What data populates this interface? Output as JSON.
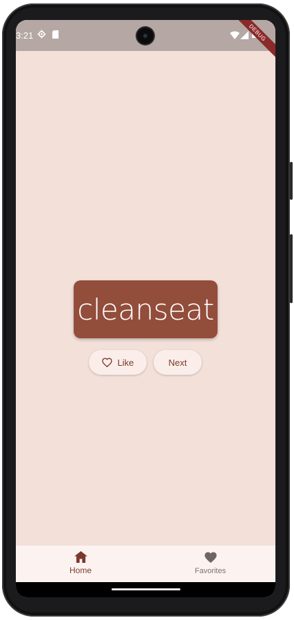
{
  "status_bar": {
    "time": "3:21",
    "left_icons": [
      "settings-icon",
      "sim-card-icon"
    ],
    "right_icons": [
      "wifi-icon",
      "signal-icon",
      "battery-icon"
    ]
  },
  "debug_banner": "DEBUG",
  "word_card": {
    "text": "cleanseat"
  },
  "actions": {
    "like_label": "Like",
    "like_icon": "heart-outline-icon",
    "next_label": "Next"
  },
  "bottom_nav": {
    "items": [
      {
        "label": "Home",
        "icon": "home-icon",
        "selected": true
      },
      {
        "label": "Favorites",
        "icon": "heart-icon",
        "selected": false
      }
    ]
  },
  "colors": {
    "background": "#f2e0d9",
    "card": "#934d3b",
    "accent": "#7a3a2b",
    "nav_background": "#fcf3f1"
  }
}
